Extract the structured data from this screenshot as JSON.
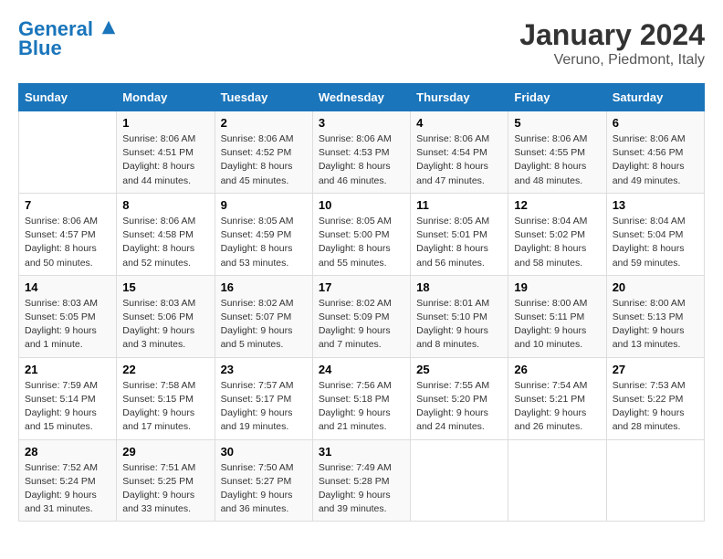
{
  "header": {
    "logo_line1": "General",
    "logo_line2": "Blue",
    "main_title": "January 2024",
    "subtitle": "Veruno, Piedmont, Italy"
  },
  "days_of_week": [
    "Sunday",
    "Monday",
    "Tuesday",
    "Wednesday",
    "Thursday",
    "Friday",
    "Saturday"
  ],
  "weeks": [
    [
      {
        "day": "",
        "info": ""
      },
      {
        "day": "1",
        "info": "Sunrise: 8:06 AM\nSunset: 4:51 PM\nDaylight: 8 hours\nand 44 minutes."
      },
      {
        "day": "2",
        "info": "Sunrise: 8:06 AM\nSunset: 4:52 PM\nDaylight: 8 hours\nand 45 minutes."
      },
      {
        "day": "3",
        "info": "Sunrise: 8:06 AM\nSunset: 4:53 PM\nDaylight: 8 hours\nand 46 minutes."
      },
      {
        "day": "4",
        "info": "Sunrise: 8:06 AM\nSunset: 4:54 PM\nDaylight: 8 hours\nand 47 minutes."
      },
      {
        "day": "5",
        "info": "Sunrise: 8:06 AM\nSunset: 4:55 PM\nDaylight: 8 hours\nand 48 minutes."
      },
      {
        "day": "6",
        "info": "Sunrise: 8:06 AM\nSunset: 4:56 PM\nDaylight: 8 hours\nand 49 minutes."
      }
    ],
    [
      {
        "day": "7",
        "info": "Sunrise: 8:06 AM\nSunset: 4:57 PM\nDaylight: 8 hours\nand 50 minutes."
      },
      {
        "day": "8",
        "info": "Sunrise: 8:06 AM\nSunset: 4:58 PM\nDaylight: 8 hours\nand 52 minutes."
      },
      {
        "day": "9",
        "info": "Sunrise: 8:05 AM\nSunset: 4:59 PM\nDaylight: 8 hours\nand 53 minutes."
      },
      {
        "day": "10",
        "info": "Sunrise: 8:05 AM\nSunset: 5:00 PM\nDaylight: 8 hours\nand 55 minutes."
      },
      {
        "day": "11",
        "info": "Sunrise: 8:05 AM\nSunset: 5:01 PM\nDaylight: 8 hours\nand 56 minutes."
      },
      {
        "day": "12",
        "info": "Sunrise: 8:04 AM\nSunset: 5:02 PM\nDaylight: 8 hours\nand 58 minutes."
      },
      {
        "day": "13",
        "info": "Sunrise: 8:04 AM\nSunset: 5:04 PM\nDaylight: 8 hours\nand 59 minutes."
      }
    ],
    [
      {
        "day": "14",
        "info": "Sunrise: 8:03 AM\nSunset: 5:05 PM\nDaylight: 9 hours\nand 1 minute."
      },
      {
        "day": "15",
        "info": "Sunrise: 8:03 AM\nSunset: 5:06 PM\nDaylight: 9 hours\nand 3 minutes."
      },
      {
        "day": "16",
        "info": "Sunrise: 8:02 AM\nSunset: 5:07 PM\nDaylight: 9 hours\nand 5 minutes."
      },
      {
        "day": "17",
        "info": "Sunrise: 8:02 AM\nSunset: 5:09 PM\nDaylight: 9 hours\nand 7 minutes."
      },
      {
        "day": "18",
        "info": "Sunrise: 8:01 AM\nSunset: 5:10 PM\nDaylight: 9 hours\nand 8 minutes."
      },
      {
        "day": "19",
        "info": "Sunrise: 8:00 AM\nSunset: 5:11 PM\nDaylight: 9 hours\nand 10 minutes."
      },
      {
        "day": "20",
        "info": "Sunrise: 8:00 AM\nSunset: 5:13 PM\nDaylight: 9 hours\nand 13 minutes."
      }
    ],
    [
      {
        "day": "21",
        "info": "Sunrise: 7:59 AM\nSunset: 5:14 PM\nDaylight: 9 hours\nand 15 minutes."
      },
      {
        "day": "22",
        "info": "Sunrise: 7:58 AM\nSunset: 5:15 PM\nDaylight: 9 hours\nand 17 minutes."
      },
      {
        "day": "23",
        "info": "Sunrise: 7:57 AM\nSunset: 5:17 PM\nDaylight: 9 hours\nand 19 minutes."
      },
      {
        "day": "24",
        "info": "Sunrise: 7:56 AM\nSunset: 5:18 PM\nDaylight: 9 hours\nand 21 minutes."
      },
      {
        "day": "25",
        "info": "Sunrise: 7:55 AM\nSunset: 5:20 PM\nDaylight: 9 hours\nand 24 minutes."
      },
      {
        "day": "26",
        "info": "Sunrise: 7:54 AM\nSunset: 5:21 PM\nDaylight: 9 hours\nand 26 minutes."
      },
      {
        "day": "27",
        "info": "Sunrise: 7:53 AM\nSunset: 5:22 PM\nDaylight: 9 hours\nand 28 minutes."
      }
    ],
    [
      {
        "day": "28",
        "info": "Sunrise: 7:52 AM\nSunset: 5:24 PM\nDaylight: 9 hours\nand 31 minutes."
      },
      {
        "day": "29",
        "info": "Sunrise: 7:51 AM\nSunset: 5:25 PM\nDaylight: 9 hours\nand 33 minutes."
      },
      {
        "day": "30",
        "info": "Sunrise: 7:50 AM\nSunset: 5:27 PM\nDaylight: 9 hours\nand 36 minutes."
      },
      {
        "day": "31",
        "info": "Sunrise: 7:49 AM\nSunset: 5:28 PM\nDaylight: 9 hours\nand 39 minutes."
      },
      {
        "day": "",
        "info": ""
      },
      {
        "day": "",
        "info": ""
      },
      {
        "day": "",
        "info": ""
      }
    ]
  ]
}
